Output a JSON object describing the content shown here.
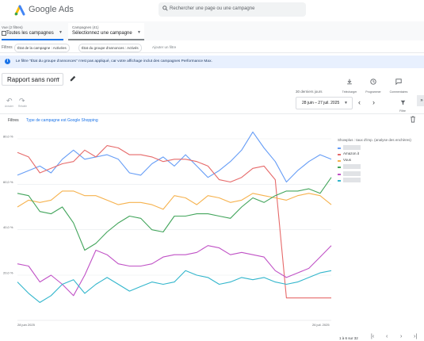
{
  "header": {
    "app_title": "Google Ads",
    "search_placeholder": "Rechercher une page ou une campagne"
  },
  "selectors": {
    "view_caption": "Vue (2 filtres)",
    "view_value": "Toutes les campagnes",
    "campaigns_caption": "Campagnes (41)",
    "campaigns_value": "Sélectionnez une campagne"
  },
  "filters_bar": {
    "label": "Filtres",
    "chips": [
      "État de la campagne : Activées",
      "État du groupe d'annonces : Activés"
    ],
    "add_filter": "Ajouter un filtre"
  },
  "info_banner": {
    "text": "Le filtre \"État du groupe d'annonces\" n'est pas appliqué, car votre affichage inclut des campagnes Performance Max."
  },
  "report": {
    "name": "Rapport sans nom",
    "toolbar": [
      {
        "label": "Télécharger",
        "icon": "download-icon"
      },
      {
        "label": "Programmer",
        "icon": "schedule-icon"
      },
      {
        "label": "Commentaires",
        "icon": "comment-icon"
      }
    ],
    "undo_label": "Annuler",
    "redo_label": "Rétablir",
    "period_caption": "30 derniers jours",
    "period_value": "28 juin – 27 juil. 2025",
    "filter_button": "Filtre",
    "active_filter_label": "Filtres",
    "active_filter_value": "Type de campagne est Google Shopping"
  },
  "chart_data": {
    "type": "line",
    "ylim": [
      0,
      85
    ],
    "yticks": [
      "80,0 %",
      "60,0 %",
      "40,0 %",
      "20,0 %"
    ],
    "x_start_label": "28 juin 2025",
    "x_end_label": "26 juil. 2025",
    "legend_title": "Showplus : taux d'imp. (analyse des enchères)",
    "series": [
      {
        "name": "",
        "color": "#669df6",
        "values": [
          64,
          66,
          68,
          65,
          71,
          75,
          71,
          72,
          73,
          71,
          65,
          64,
          69,
          72,
          68,
          73,
          68,
          63,
          66,
          70,
          75,
          83,
          76,
          70,
          61,
          66,
          70,
          73,
          71
        ]
      },
      {
        "name": "Amazon.it",
        "color": "#e66a6a",
        "values": [
          74,
          72,
          65,
          67,
          69,
          70,
          75,
          72,
          77,
          76,
          73,
          73,
          72,
          70,
          71,
          71,
          70,
          68,
          62,
          61,
          63,
          67,
          68,
          62,
          10,
          10,
          10,
          10,
          10
        ]
      },
      {
        "name": "Vous",
        "color": "#f6b24e",
        "values": [
          50,
          53,
          52,
          53,
          57,
          57,
          55,
          55,
          53,
          51,
          52,
          52,
          51,
          49,
          55,
          54,
          51,
          55,
          54,
          52,
          53,
          56,
          55,
          54,
          53,
          55,
          56,
          55,
          51
        ]
      },
      {
        "name": "",
        "color": "#43a55c",
        "values": [
          56,
          55,
          48,
          47,
          50,
          43,
          31,
          34,
          39,
          43,
          46,
          45,
          40,
          39,
          46,
          46,
          47,
          47,
          46,
          45,
          50,
          54,
          52,
          55,
          57,
          57,
          58,
          56,
          63
        ]
      },
      {
        "name": "",
        "color": "#c052c6",
        "values": [
          25,
          24,
          17,
          20,
          16,
          11,
          20,
          31,
          29,
          25,
          24,
          24,
          25,
          28,
          29,
          29,
          30,
          33,
          32,
          29,
          30,
          29,
          28,
          22,
          19,
          21,
          23,
          28,
          33
        ]
      },
      {
        "name": "",
        "color": "#33b6cc",
        "values": [
          17,
          12,
          8,
          11,
          16,
          18,
          12,
          16,
          19,
          16,
          13,
          15,
          17,
          16,
          17,
          22,
          20,
          19,
          16,
          17,
          19,
          18,
          19,
          17,
          16,
          17,
          19,
          21,
          22
        ]
      }
    ]
  },
  "pagination": {
    "range_text": "1 à 6 sur 32"
  }
}
